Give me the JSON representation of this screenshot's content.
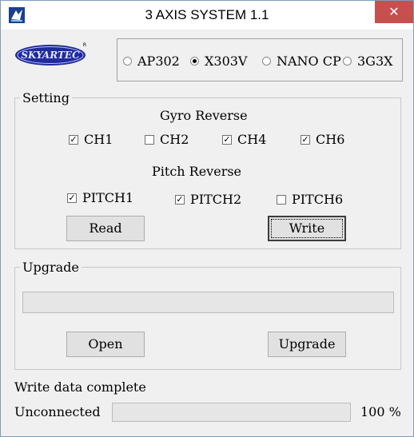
{
  "window": {
    "title": "3 AXIS SYSTEM 1.1",
    "close_symbol": "✕"
  },
  "logo": {
    "text": "SKYARTEC",
    "registered": "R"
  },
  "models": [
    {
      "label": "AP302",
      "selected": false
    },
    {
      "label": "X303V",
      "selected": true
    },
    {
      "label": "NANO CP",
      "selected": false
    },
    {
      "label": "3G3X",
      "selected": false
    }
  ],
  "setting": {
    "legend": "Setting",
    "gyro_heading": "Gyro Reverse",
    "gyro": [
      {
        "label": "CH1",
        "checked": true
      },
      {
        "label": "CH2",
        "checked": false
      },
      {
        "label": "CH4",
        "checked": true
      },
      {
        "label": "CH6",
        "checked": true
      }
    ],
    "pitch_heading": "Pitch Reverse",
    "pitch": [
      {
        "label": "PITCH1",
        "checked": true
      },
      {
        "label": "PITCH2",
        "checked": true
      },
      {
        "label": "PITCH6",
        "checked": false
      }
    ],
    "read_label": "Read",
    "write_label": "Write"
  },
  "upgrade": {
    "legend": "Upgrade",
    "progress": 0,
    "open_label": "Open",
    "upgrade_label": "Upgrade"
  },
  "status": {
    "message": "Write data complete",
    "connection": "Unconnected",
    "progress_percent": 100,
    "progress_text": "100 %"
  }
}
